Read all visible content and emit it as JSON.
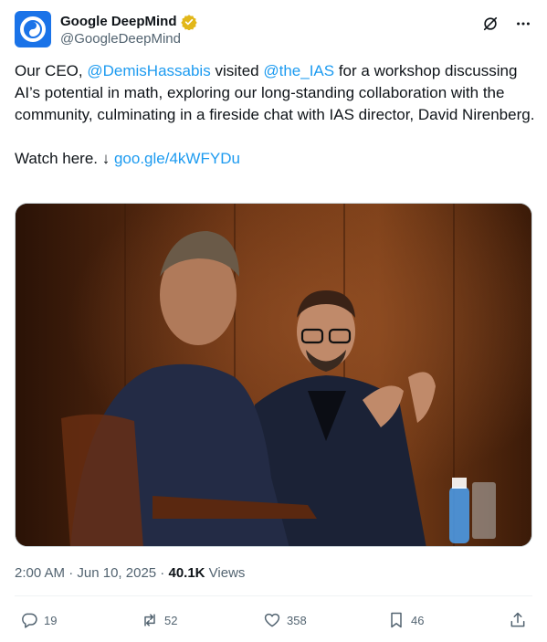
{
  "author": {
    "display_name": "Google DeepMind",
    "handle": "@GoogleDeepMind",
    "verified": true,
    "avatar_icon": "deepmind-logo-icon",
    "avatar_color": "#1a73e8"
  },
  "header_icons": [
    "grok-icon",
    "more-icon"
  ],
  "tweet": {
    "line1_pre": "Our CEO, ",
    "mention1": "@DemisHassabis",
    "line1_mid": " visited ",
    "mention2": "@the_IAS",
    "line1_post": " for a workshop discussing AI’s potential in math, exploring our long-standing collaboration with the community, culminating in a fireside chat with IAS director, David Nirenberg.",
    "watch_pre": "Watch here. ↓ ",
    "link": "goo.gle/4kWFYDu"
  },
  "meta": {
    "time": "2:00 AM",
    "sep1": " · ",
    "date": "Jun 10, 2025",
    "sep2": " · ",
    "views_count": "40.1K",
    "views_label": " Views"
  },
  "actions": {
    "replies": "19",
    "reposts": "52",
    "likes": "358",
    "bookmarks": "46"
  },
  "colors": {
    "link": "#1d9bf0",
    "secondary_text": "#536471",
    "verified_gold": "#e2b719"
  }
}
